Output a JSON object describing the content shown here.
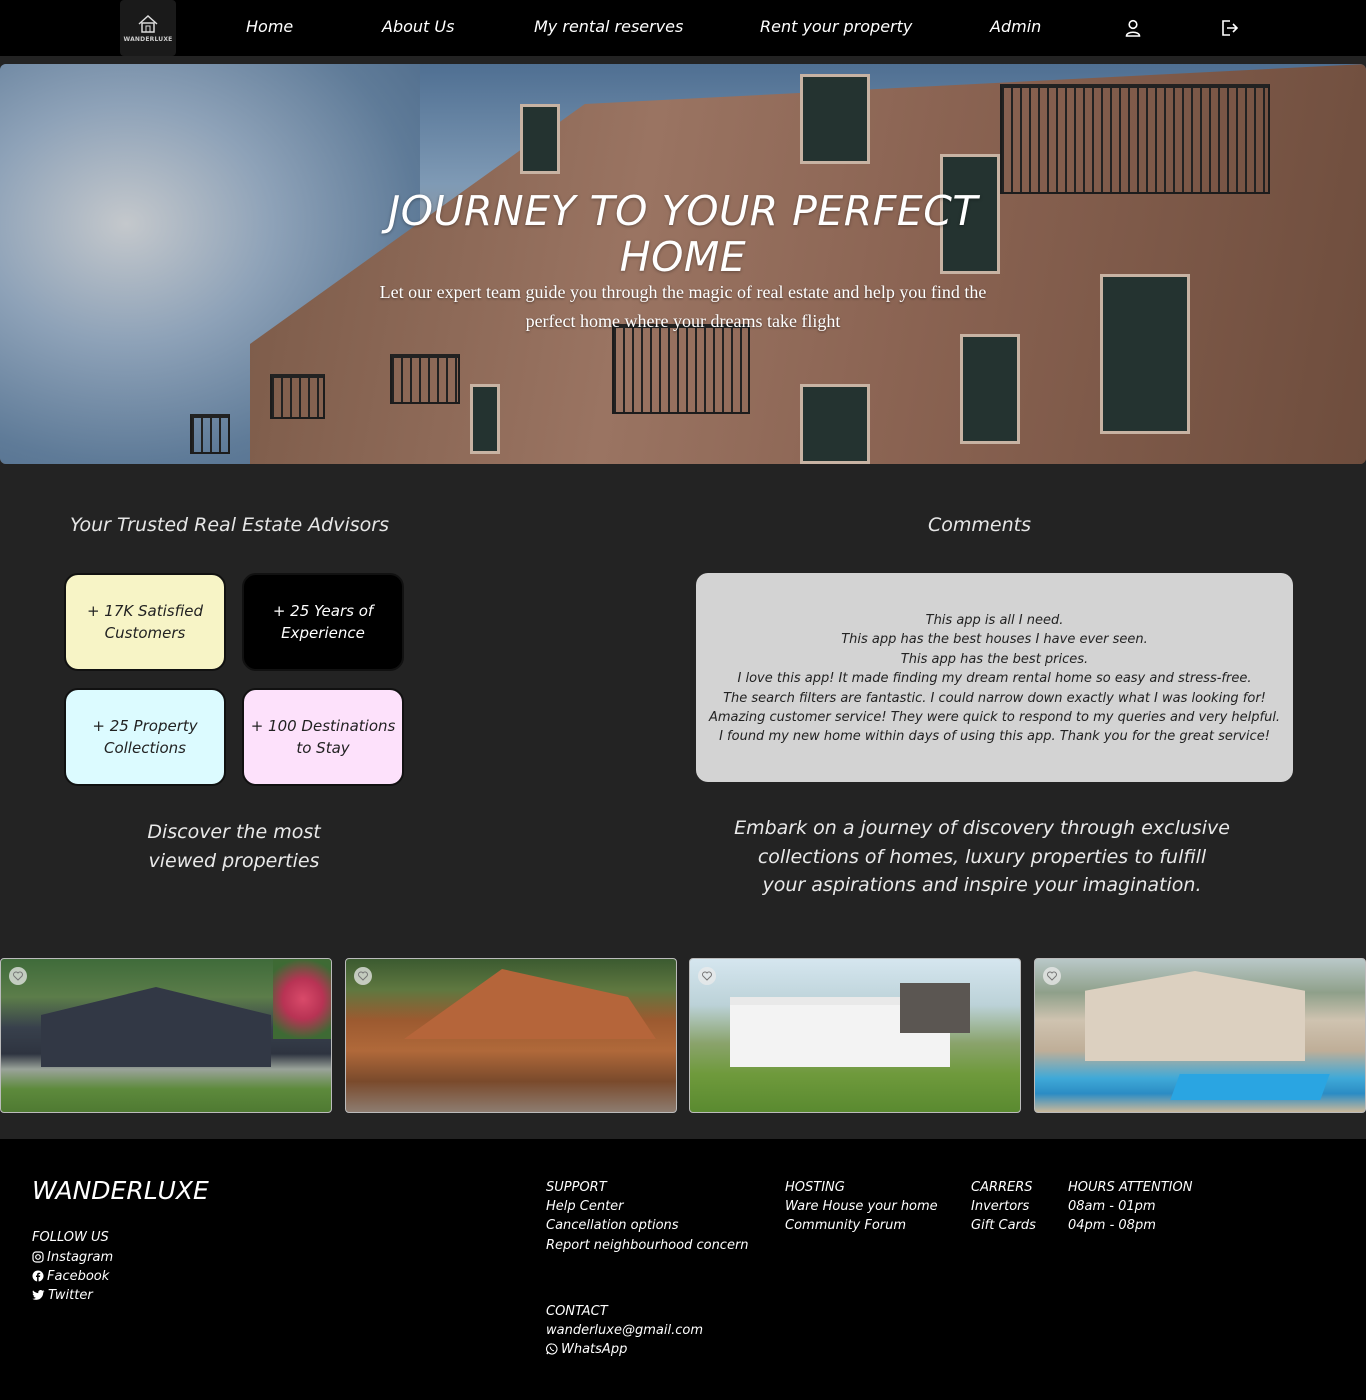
{
  "nav": {
    "logo_text": "WANDERLUXE",
    "links": [
      "Home",
      "About Us",
      "My rental reserves",
      "Rent your property",
      "Admin"
    ]
  },
  "hero": {
    "title_line1": "JOURNEY TO YOUR PERFECT",
    "title_line2": "HOME",
    "subtitle_line1": "Let our expert team guide you through the magic of real estate and help you find the",
    "subtitle_line2": "perfect home where your dreams take flight"
  },
  "advisors": {
    "title": "Your Trusted Real Estate Advisors",
    "stats": [
      {
        "text": "+ 17K Satisfied Customers",
        "bg": "#f7f4c6",
        "color": "#222"
      },
      {
        "text": "+ 25 Years of Experience",
        "bg": "#000000",
        "color": "#ffffff"
      },
      {
        "text": "+ 25 Property Collections",
        "bg": "#dcfbff",
        "color": "#222"
      },
      {
        "text": "+ 100 Destinations to Stay",
        "bg": "#fde1fb",
        "color": "#222"
      }
    ],
    "discover_line1": "Discover the most",
    "discover_line2": "viewed properties"
  },
  "comments": {
    "title": "Comments",
    "items": [
      "This app is all I need.",
      "This app has the best houses I have ever seen.",
      "This app has the best prices.",
      "I love this app! It made finding my dream rental home so easy and stress-free.",
      "The search filters are fantastic. I could narrow down exactly what I was looking for!",
      "Amazing customer service! They were quick to respond to my queries and very helpful.",
      "I found my new home within days of using this app. Thank you for the great service!"
    ],
    "embark_line1": "Embark on a journey of discovery through exclusive",
    "embark_line2": "collections of homes, luxury properties to fulfill",
    "embark_line3": "your aspirations and inspire your imagination."
  },
  "properties": [
    "property-1",
    "property-2",
    "property-3",
    "property-4"
  ],
  "footer": {
    "brand": "WANDERLUXE",
    "follow_title": "FOLLOW US",
    "social": [
      "Instagram",
      "Facebook",
      "Twitter"
    ],
    "support_title": "SUPPORT",
    "support_links": [
      "Help Center",
      "Cancellation options",
      "Report neighbourhood concern"
    ],
    "hosting_title": "HOSTING",
    "hosting_links": [
      "Ware House your home",
      "Community Forum"
    ],
    "carrers_title": "CARRERS",
    "carrers_links": [
      "Invertors",
      "Gift Cards"
    ],
    "hours_title": "HOURS ATTENTION",
    "hours": [
      "08am - 01pm",
      "04pm - 08pm"
    ],
    "contact_title": "CONTACT",
    "email": "wanderluxe@gmail.com",
    "whatsapp": "WhatsApp"
  }
}
